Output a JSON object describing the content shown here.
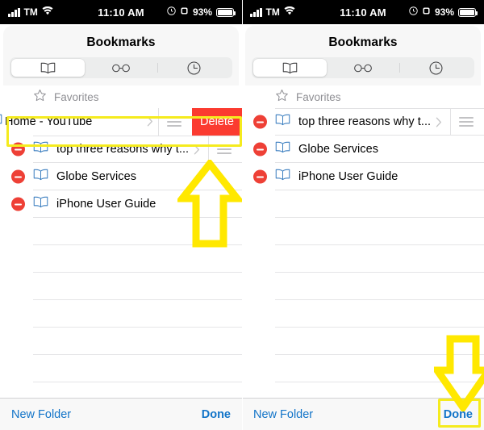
{
  "status_bar": {
    "carrier": "TM",
    "signal_icon": "cellular-bars-icon",
    "wifi_icon": "wifi-icon",
    "time": "11:10 AM",
    "alarm_icon": "alarm-clock-icon",
    "rotation_lock_icon": "rotation-lock-icon",
    "battery_percent": "93%",
    "battery_icon": "battery-icon"
  },
  "panels": [
    {
      "id": "left",
      "nav": {
        "title": "Bookmarks"
      },
      "segments": [
        {
          "icon": "open-book-icon",
          "label": "",
          "selected": true
        },
        {
          "icon": "reading-list-glasses-icon",
          "label": "",
          "selected": false
        },
        {
          "icon": "history-clock-icon",
          "label": "",
          "selected": false
        }
      ],
      "section_header": {
        "icon": "star-icon",
        "label": "Favorites"
      },
      "swiped_row": {
        "label": "Home - YouTube",
        "icon": "open-book-icon",
        "delete_label": "Delete",
        "chevron": "chevron-right-icon",
        "handle": "reorder-handle-icon"
      },
      "rows": [
        {
          "label": "top three reasons why t...",
          "icon": "open-book-icon",
          "delete_badge": "minus-circle-icon",
          "chevron": "chevron-right-icon",
          "handle": "reorder-handle-icon"
        },
        {
          "label": "Globe Services",
          "icon": "open-book-icon",
          "delete_badge": "minus-circle-icon",
          "chevron": "",
          "handle": ""
        },
        {
          "label": "iPhone User Guide",
          "icon": "open-book-icon",
          "delete_badge": "minus-circle-icon",
          "chevron": "",
          "handle": ""
        }
      ],
      "toolbar": {
        "new_folder": "New Folder",
        "done": "Done"
      }
    },
    {
      "id": "right",
      "nav": {
        "title": "Bookmarks"
      },
      "segments": [
        {
          "icon": "open-book-icon",
          "label": "",
          "selected": true
        },
        {
          "icon": "reading-list-glasses-icon",
          "label": "",
          "selected": false
        },
        {
          "icon": "history-clock-icon",
          "label": "",
          "selected": false
        }
      ],
      "section_header": {
        "icon": "star-icon",
        "label": "Favorites"
      },
      "rows": [
        {
          "label": "top three reasons why t...",
          "icon": "open-book-icon",
          "delete_badge": "minus-circle-icon",
          "chevron": "chevron-right-icon",
          "handle": "reorder-handle-icon"
        },
        {
          "label": "Globe Services",
          "icon": "open-book-icon",
          "delete_badge": "minus-circle-icon",
          "chevron": "",
          "handle": ""
        },
        {
          "label": "iPhone User Guide",
          "icon": "open-book-icon",
          "delete_badge": "minus-circle-icon",
          "chevron": "",
          "handle": ""
        }
      ],
      "toolbar": {
        "new_folder": "New Folder",
        "done": "Done"
      }
    }
  ],
  "annotations": {
    "highlight_color": "#f5eb1e",
    "arrow_color": "#ffe800",
    "up_arrow_name": "up-arrow-annotation",
    "down_arrow_name": "down-arrow-annotation",
    "swiped_row_highlight_name": "swiped-row-highlight",
    "done_button_highlight_name": "done-button-highlight"
  },
  "colors": {
    "delete_red": "#fb3b30",
    "minus_red": "#ee4036",
    "link_blue": "#1274c8",
    "book_blue": "#3c7fc0"
  }
}
